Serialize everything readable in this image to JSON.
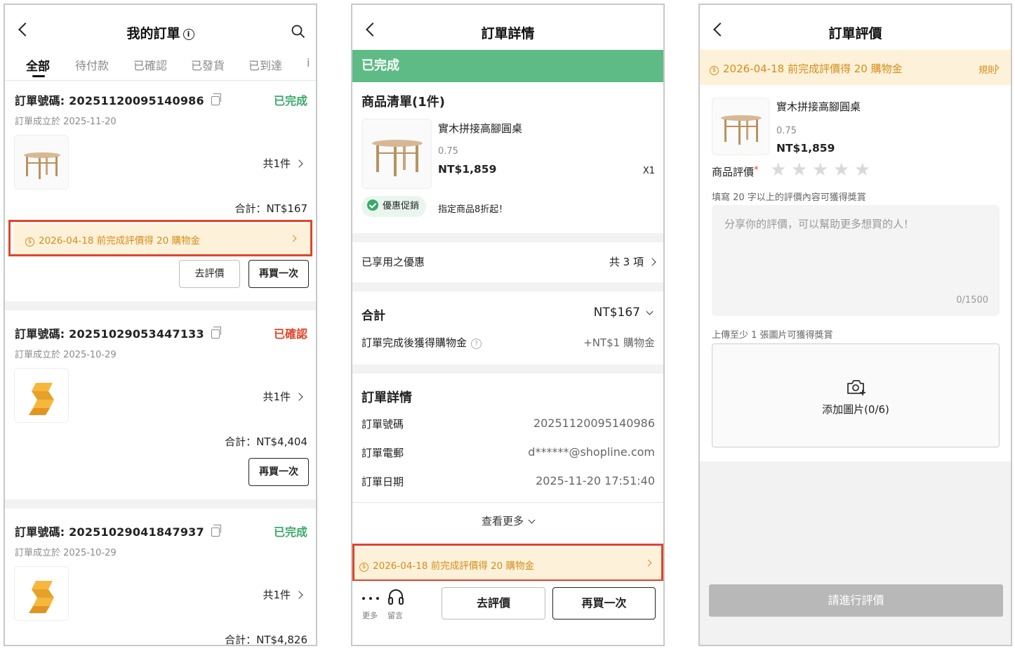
{
  "panel1": {
    "title": "我的訂單",
    "tabs": [
      "全部",
      "待付款",
      "已確認",
      "已發貨",
      "已到達",
      "i"
    ],
    "orders": [
      {
        "number": "訂單號碼: 20251120095140986",
        "status": "已完成",
        "status_color": "#3aa96a",
        "date": "訂單成立於 2025-11-20",
        "count": "共1件",
        "total": "合計：NT$167",
        "promo": "2026-04-18 前完成評價得 20 購物金",
        "buttons": [
          "去評價",
          "再買一次"
        ],
        "thumb": "table"
      },
      {
        "number": "訂單號碼: 20251029053447133",
        "status": "已確認",
        "status_color": "#e0452a",
        "date": "訂單成立於 2025-10-29",
        "count": "共1件",
        "total": "合計：NT$4,404",
        "buttons": [
          "再買一次"
        ],
        "thumb": "logo"
      },
      {
        "number": "訂單號碼: 20251029041847937",
        "status": "已完成",
        "status_color": "#3aa96a",
        "date": "訂單成立於 2025-10-29",
        "count": "共1件",
        "total": "合計：NT$4,826",
        "thumb": "logo"
      }
    ]
  },
  "panel2": {
    "title": "訂單詳情",
    "status_bar": "已完成",
    "items_title": "商品清單(1件)",
    "item": {
      "name": "實木拼接高腳圓桌",
      "variant": "0.75",
      "price": "NT$1,859",
      "qty": "X1"
    },
    "promo_chip": "優惠促銷",
    "promo_text": "指定商品8折起！",
    "discounts_label": "已享用之優惠",
    "discounts_value": "共 3 項",
    "total_label": "合計",
    "total_value": "NT$167",
    "reward_label": "訂單完成後獲得購物金",
    "reward_value": "+NT$1 購物金",
    "details_title": "訂單詳情",
    "details": [
      {
        "label": "訂單號碼",
        "value": "20251120095140986"
      },
      {
        "label": "訂單電郵",
        "value": "d******@shopline.com"
      },
      {
        "label": "訂單日期",
        "value": "2025-11-20 17:51:40"
      }
    ],
    "more": "查看更多",
    "promo": "2026-04-18 前完成評價得 20 購物金",
    "bottom": {
      "more_label": "更多",
      "msg_label": "留言",
      "review_btn": "去評價",
      "rebuy_btn": "再買一次"
    }
  },
  "panel3": {
    "title": "訂單評價",
    "banner": "2026-04-18 前完成評價得 20 購物金",
    "rules": "規則",
    "item": {
      "name": "實木拼接高腳圓桌",
      "variant": "0.75",
      "price": "NT$1,859"
    },
    "rating_label": "商品評價",
    "required_mark": "*",
    "hint": "填寫 20 字以上的評價內容可獲得獎賞",
    "placeholder": "分享你的評價，可以幫助更多想買的人！",
    "counter": "0/1500",
    "upload_hint": "上傳至少 1 張圖片可獲得獎賞",
    "upload_label": "添加圖片(0/6)",
    "submit": "請進行評價"
  },
  "colors": {
    "highlight": "#e0452a",
    "promo_text": "#d38e1c",
    "promo_bg": "#fdf1d9",
    "success": "#5fbb86"
  }
}
